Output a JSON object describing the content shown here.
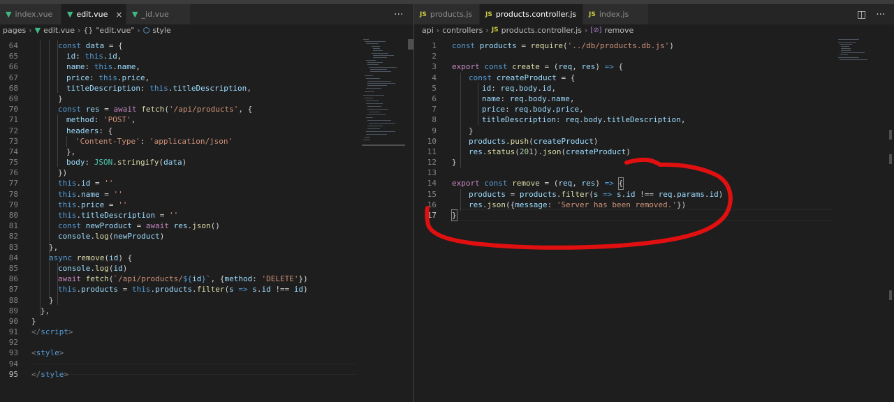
{
  "left": {
    "tabs": [
      {
        "label": "index.vue",
        "active": false
      },
      {
        "label": "edit.vue",
        "active": true,
        "close": "×"
      },
      {
        "label": "_id.vue",
        "active": false
      }
    ],
    "more": "···",
    "breadcrumb": {
      "a": "pages",
      "b": "edit.vue",
      "c": "{}",
      "d": "\"edit.vue\"",
      "e": "style"
    },
    "line_numbers": [
      "64",
      "65",
      "66",
      "67",
      "68",
      "69",
      "70",
      "71",
      "72",
      "73",
      "74",
      "75",
      "76",
      "77",
      "78",
      "79",
      "80",
      "81",
      "82",
      "83",
      "84",
      "85",
      "86",
      "87",
      "88",
      "89",
      "90",
      "91",
      "92",
      "93",
      "94",
      "95"
    ]
  },
  "right": {
    "tabs": [
      {
        "label": "products.js",
        "active": false,
        "icon": "JS"
      },
      {
        "label": "products.controller.js",
        "active": true,
        "icon": "JS",
        "close": "×"
      },
      {
        "label": "index.js",
        "active": false,
        "icon": "JS"
      }
    ],
    "tools": {
      "split": "◫",
      "more": "···"
    },
    "breadcrumb": {
      "a": "api",
      "b": "controllers",
      "c": "JS",
      "d": "products.controller.js",
      "e": "[⊘]",
      "f": "remove"
    },
    "line_numbers": [
      "1",
      "2",
      "3",
      "4",
      "5",
      "6",
      "7",
      "8",
      "9",
      "10",
      "11",
      "12",
      "13",
      "14",
      "15",
      "16",
      "17"
    ]
  },
  "colors": {
    "annotation_red": "#e01010",
    "editor_bg": "#1e1e1e",
    "vue_green": "#41b883",
    "js_yellow": "#cbcb41"
  },
  "icons": [
    "vue-file-icon",
    "js-file-icon",
    "close-icon",
    "split-editor-icon",
    "more-actions-icon",
    "symbol-object-icon",
    "symbol-variable-icon"
  ]
}
